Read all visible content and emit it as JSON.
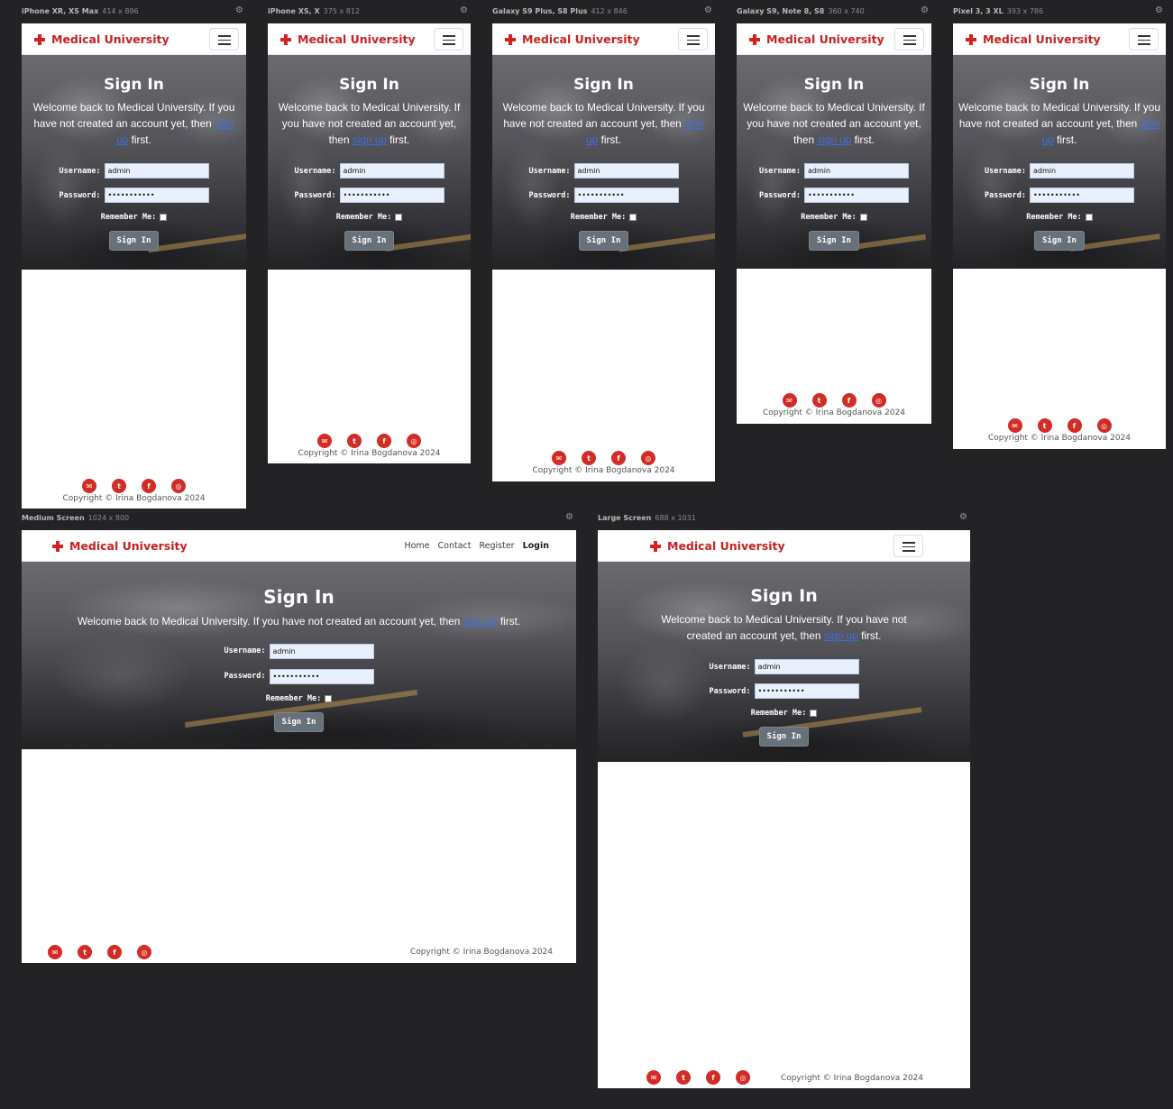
{
  "devices": [
    {
      "name": "iPhone XR, XS Max",
      "size": "414 x 896"
    },
    {
      "name": "iPhone XS, X",
      "size": "375 x 812"
    },
    {
      "name": "Galaxy S9 Plus, S8 Plus",
      "size": "412 x 846"
    },
    {
      "name": "Galaxy S9, Note 8, S8",
      "size": "360 x 740"
    },
    {
      "name": "Pixel 3, 3 XL",
      "size": "393 x 786"
    },
    {
      "name": "Medium Screen",
      "size": "1024 x 800"
    },
    {
      "name": "Large Screen",
      "size": "688 x 1031"
    }
  ],
  "brand": "Medical University",
  "nav": {
    "home": "Home",
    "contact": "Contact",
    "register": "Register",
    "login": "Login"
  },
  "page": {
    "title": "Sign In",
    "intro_before": "Welcome back to Medical University. If you have not created an account yet, then",
    "signup_link": "sign up",
    "intro_after": "first."
  },
  "form": {
    "username_label": "Username:",
    "username_value": "admin",
    "password_label": "Password:",
    "password_value": "•••••••••••",
    "remember_label": "Remember Me:",
    "submit_label": "Sign In"
  },
  "footer": {
    "copyright": "Copyright © Irina Bogdanova 2024",
    "socials": [
      "envelope-icon",
      "twitter-icon",
      "facebook-icon",
      "instagram-icon"
    ]
  },
  "colors": {
    "brand": "#c8211f",
    "link": "#3d6fe0",
    "button": "#687079",
    "page_bg": "#232325"
  }
}
